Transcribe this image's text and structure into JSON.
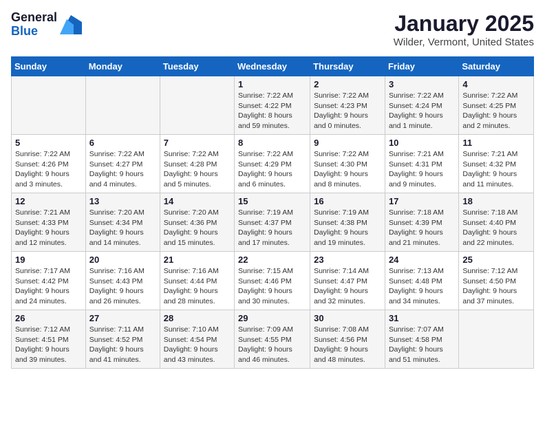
{
  "header": {
    "logo_general": "General",
    "logo_blue": "Blue",
    "title": "January 2025",
    "subtitle": "Wilder, Vermont, United States"
  },
  "weekdays": [
    "Sunday",
    "Monday",
    "Tuesday",
    "Wednesday",
    "Thursday",
    "Friday",
    "Saturday"
  ],
  "weeks": [
    [
      {
        "day": "",
        "info": ""
      },
      {
        "day": "",
        "info": ""
      },
      {
        "day": "",
        "info": ""
      },
      {
        "day": "1",
        "info": "Sunrise: 7:22 AM\nSunset: 4:22 PM\nDaylight: 8 hours and 59 minutes."
      },
      {
        "day": "2",
        "info": "Sunrise: 7:22 AM\nSunset: 4:23 PM\nDaylight: 9 hours and 0 minutes."
      },
      {
        "day": "3",
        "info": "Sunrise: 7:22 AM\nSunset: 4:24 PM\nDaylight: 9 hours and 1 minute."
      },
      {
        "day": "4",
        "info": "Sunrise: 7:22 AM\nSunset: 4:25 PM\nDaylight: 9 hours and 2 minutes."
      }
    ],
    [
      {
        "day": "5",
        "info": "Sunrise: 7:22 AM\nSunset: 4:26 PM\nDaylight: 9 hours and 3 minutes."
      },
      {
        "day": "6",
        "info": "Sunrise: 7:22 AM\nSunset: 4:27 PM\nDaylight: 9 hours and 4 minutes."
      },
      {
        "day": "7",
        "info": "Sunrise: 7:22 AM\nSunset: 4:28 PM\nDaylight: 9 hours and 5 minutes."
      },
      {
        "day": "8",
        "info": "Sunrise: 7:22 AM\nSunset: 4:29 PM\nDaylight: 9 hours and 6 minutes."
      },
      {
        "day": "9",
        "info": "Sunrise: 7:22 AM\nSunset: 4:30 PM\nDaylight: 9 hours and 8 minutes."
      },
      {
        "day": "10",
        "info": "Sunrise: 7:21 AM\nSunset: 4:31 PM\nDaylight: 9 hours and 9 minutes."
      },
      {
        "day": "11",
        "info": "Sunrise: 7:21 AM\nSunset: 4:32 PM\nDaylight: 9 hours and 11 minutes."
      }
    ],
    [
      {
        "day": "12",
        "info": "Sunrise: 7:21 AM\nSunset: 4:33 PM\nDaylight: 9 hours and 12 minutes."
      },
      {
        "day": "13",
        "info": "Sunrise: 7:20 AM\nSunset: 4:34 PM\nDaylight: 9 hours and 14 minutes."
      },
      {
        "day": "14",
        "info": "Sunrise: 7:20 AM\nSunset: 4:36 PM\nDaylight: 9 hours and 15 minutes."
      },
      {
        "day": "15",
        "info": "Sunrise: 7:19 AM\nSunset: 4:37 PM\nDaylight: 9 hours and 17 minutes."
      },
      {
        "day": "16",
        "info": "Sunrise: 7:19 AM\nSunset: 4:38 PM\nDaylight: 9 hours and 19 minutes."
      },
      {
        "day": "17",
        "info": "Sunrise: 7:18 AM\nSunset: 4:39 PM\nDaylight: 9 hours and 21 minutes."
      },
      {
        "day": "18",
        "info": "Sunrise: 7:18 AM\nSunset: 4:40 PM\nDaylight: 9 hours and 22 minutes."
      }
    ],
    [
      {
        "day": "19",
        "info": "Sunrise: 7:17 AM\nSunset: 4:42 PM\nDaylight: 9 hours and 24 minutes."
      },
      {
        "day": "20",
        "info": "Sunrise: 7:16 AM\nSunset: 4:43 PM\nDaylight: 9 hours and 26 minutes."
      },
      {
        "day": "21",
        "info": "Sunrise: 7:16 AM\nSunset: 4:44 PM\nDaylight: 9 hours and 28 minutes."
      },
      {
        "day": "22",
        "info": "Sunrise: 7:15 AM\nSunset: 4:46 PM\nDaylight: 9 hours and 30 minutes."
      },
      {
        "day": "23",
        "info": "Sunrise: 7:14 AM\nSunset: 4:47 PM\nDaylight: 9 hours and 32 minutes."
      },
      {
        "day": "24",
        "info": "Sunrise: 7:13 AM\nSunset: 4:48 PM\nDaylight: 9 hours and 34 minutes."
      },
      {
        "day": "25",
        "info": "Sunrise: 7:12 AM\nSunset: 4:50 PM\nDaylight: 9 hours and 37 minutes."
      }
    ],
    [
      {
        "day": "26",
        "info": "Sunrise: 7:12 AM\nSunset: 4:51 PM\nDaylight: 9 hours and 39 minutes."
      },
      {
        "day": "27",
        "info": "Sunrise: 7:11 AM\nSunset: 4:52 PM\nDaylight: 9 hours and 41 minutes."
      },
      {
        "day": "28",
        "info": "Sunrise: 7:10 AM\nSunset: 4:54 PM\nDaylight: 9 hours and 43 minutes."
      },
      {
        "day": "29",
        "info": "Sunrise: 7:09 AM\nSunset: 4:55 PM\nDaylight: 9 hours and 46 minutes."
      },
      {
        "day": "30",
        "info": "Sunrise: 7:08 AM\nSunset: 4:56 PM\nDaylight: 9 hours and 48 minutes."
      },
      {
        "day": "31",
        "info": "Sunrise: 7:07 AM\nSunset: 4:58 PM\nDaylight: 9 hours and 51 minutes."
      },
      {
        "day": "",
        "info": ""
      }
    ]
  ]
}
